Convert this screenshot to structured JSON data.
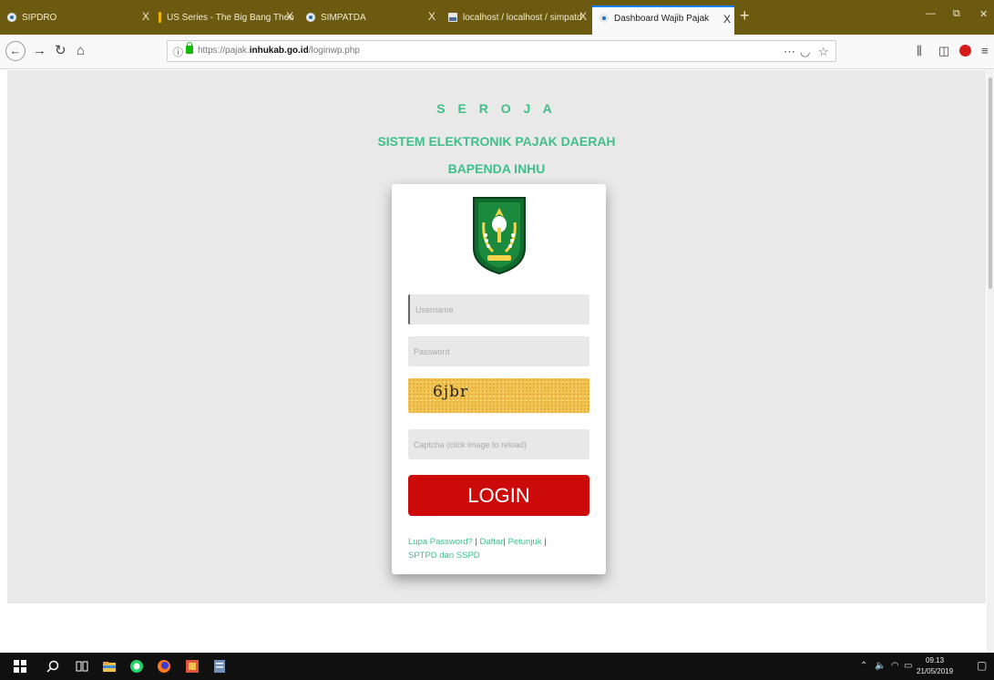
{
  "browser": {
    "tabs": [
      {
        "title": "SIPDRO",
        "active": false
      },
      {
        "title": "US Series - The Big Bang Theo",
        "active": false
      },
      {
        "title": "SIMPATDA",
        "active": false
      },
      {
        "title": "localhost / localhost / simpatd",
        "active": false
      },
      {
        "title": "Dashboard Wajib Pajak",
        "active": true
      }
    ],
    "close_glyph": "X",
    "new_tab_glyph": "+",
    "url": {
      "prefix": "https://pajak.",
      "domain": "inhukab.go.id",
      "path": "/loginwp.php"
    }
  },
  "header": {
    "app_name": "S E R O J A",
    "system_name": "SISTEM ELEKTRONIK PAJAK DAERAH",
    "agency": "BAPENDA INHU"
  },
  "form": {
    "username_placeholder": "Username",
    "password_placeholder": "Password",
    "captcha_text": "6jbr",
    "captcha_placeholder": "Captcha (click image to reload)",
    "login_label": "LOGIN"
  },
  "links": {
    "forgot_password": "Lupa Password?",
    "register": "Daftar",
    "guide": "Petunjuk",
    "sptpd": "SPTPD dan SSPD",
    "separator": "|"
  },
  "taskbar": {
    "time": "09.13",
    "date": "21/05/2019"
  },
  "colors": {
    "tabbar": "#6b5a10",
    "brand_green": "#3fbf8a",
    "login_red": "#cc0a0a",
    "captcha_yellow": "#f2c24e",
    "page_gray": "#e9e9e9"
  },
  "icons": [
    "firefox-tab-icon",
    "back-icon",
    "forward-icon",
    "reload-icon",
    "home-icon",
    "info-icon",
    "lock-icon",
    "page-actions-icon",
    "pocket-icon",
    "bookmark-star-icon",
    "library-icon",
    "sidebar-icon",
    "adblock-icon",
    "menu-icon",
    "windows-start-icon",
    "search-icon",
    "task-view-icon",
    "file-explorer-icon",
    "whatsapp-icon",
    "firefox-icon",
    "app-icon",
    "notes-icon"
  ]
}
